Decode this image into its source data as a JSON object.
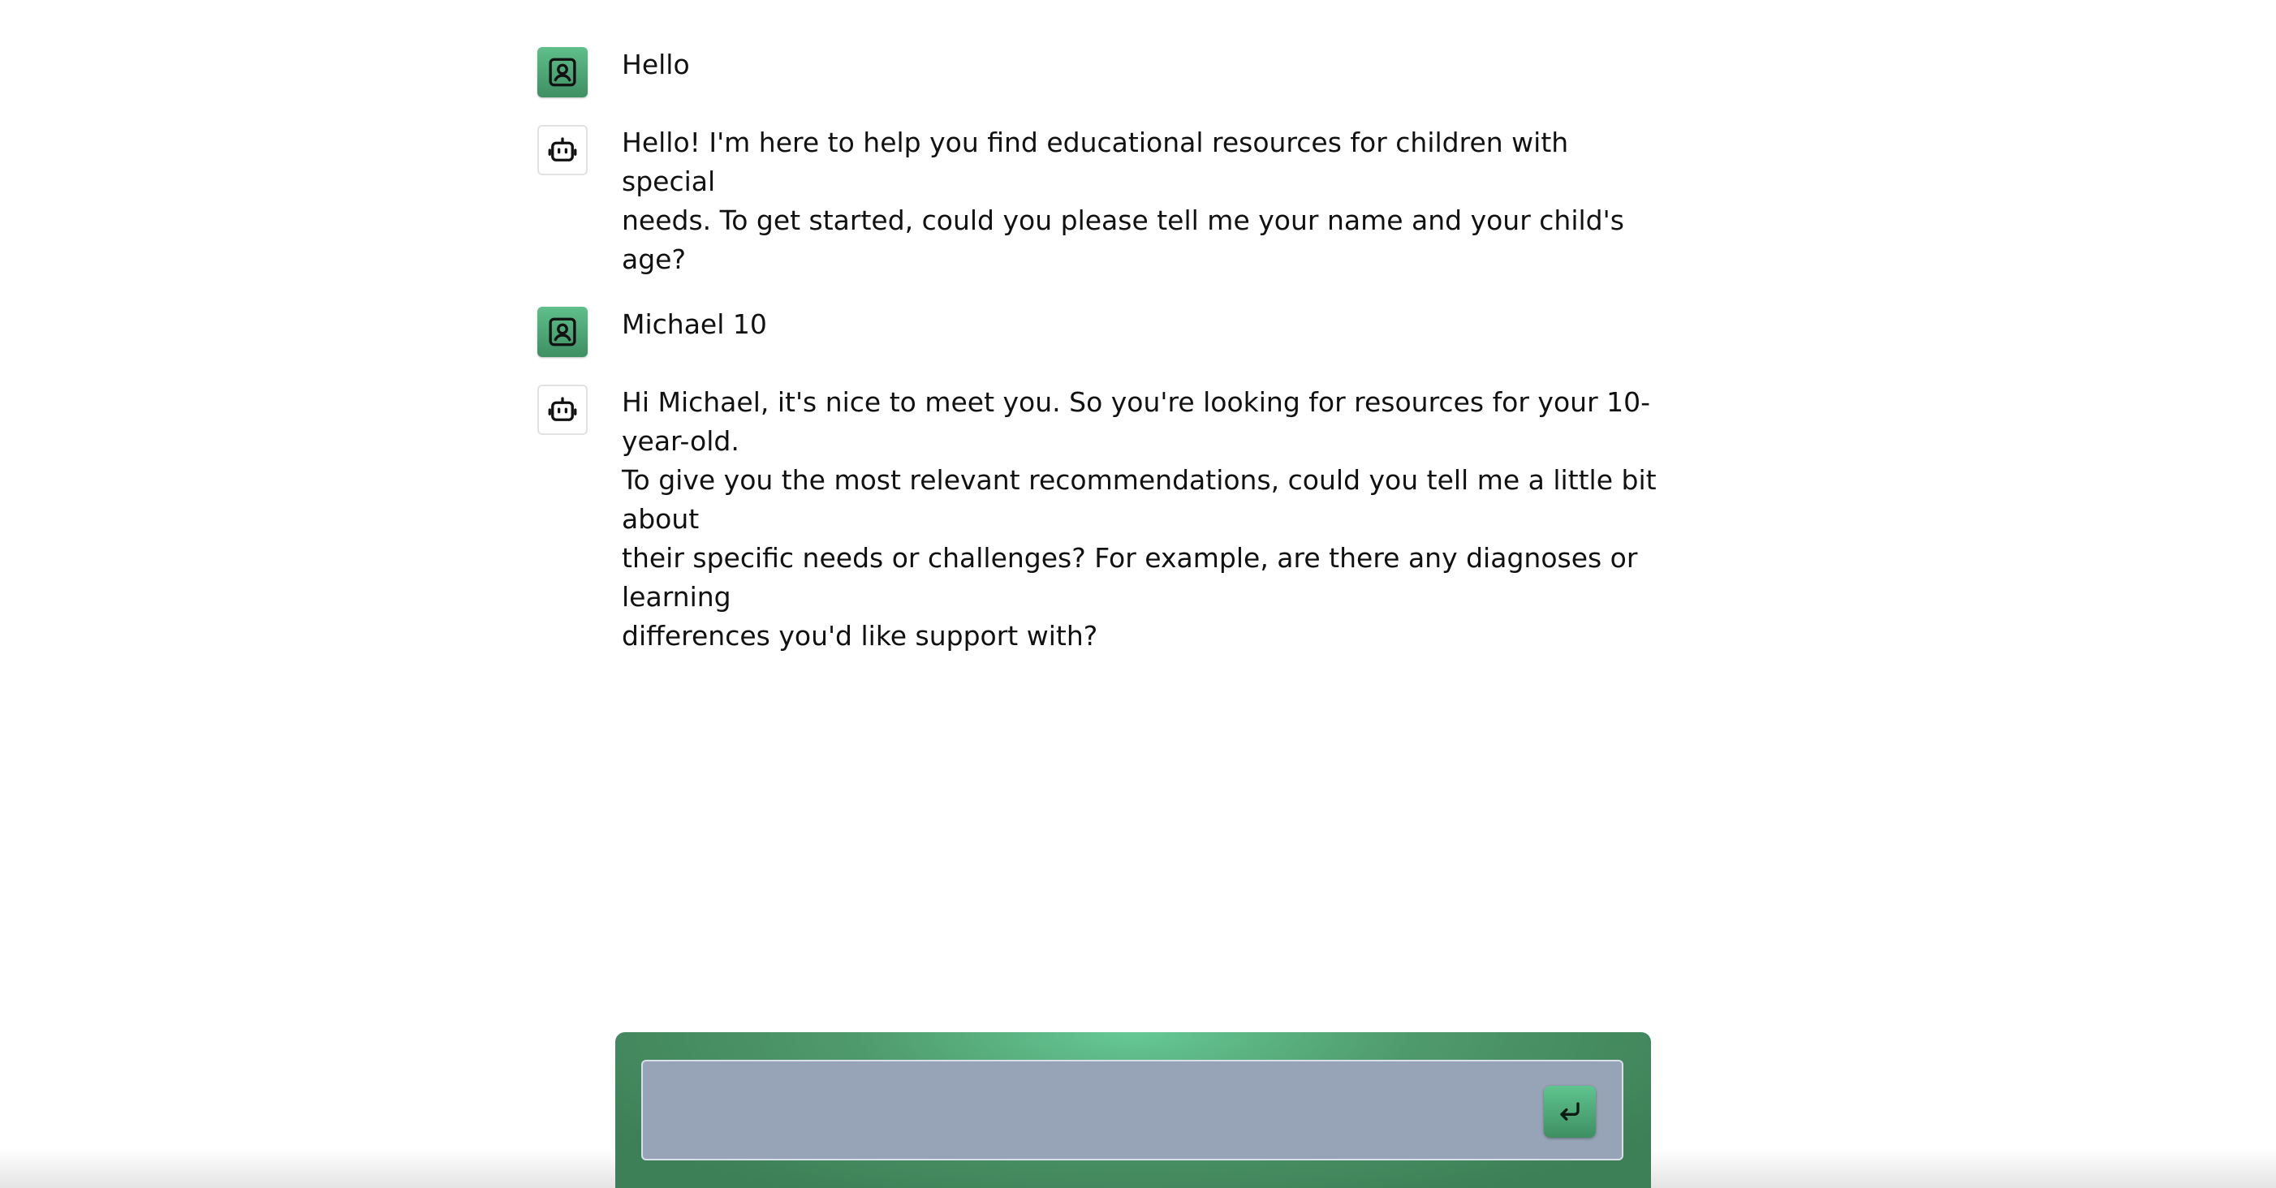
{
  "messages": [
    {
      "role": "user",
      "avatar_icon": "user-portrait-icon",
      "text": "Hello"
    },
    {
      "role": "assistant",
      "avatar_icon": "robot-icon",
      "text": "Hello! I'm here to help you find educational resources for children with special\nneeds. To get started, could you please tell me your name and your child's age?"
    },
    {
      "role": "user",
      "avatar_icon": "user-portrait-icon",
      "text": "Michael 10"
    },
    {
      "role": "assistant",
      "avatar_icon": "robot-icon",
      "text": "Hi Michael, it's nice to meet you. So you're looking for resources for your 10-year-old.\nTo give you the most relevant recommendations, could you tell me a little bit about\ntheir specific needs or challenges? For example, are there any diagnoses or learning\ndifferences you'd like support with?"
    }
  ],
  "composer": {
    "value": "",
    "send_icon": "enter-return-icon"
  },
  "colors": {
    "accent_green": "#4f9a6c",
    "input_background": "#97a3b6"
  }
}
